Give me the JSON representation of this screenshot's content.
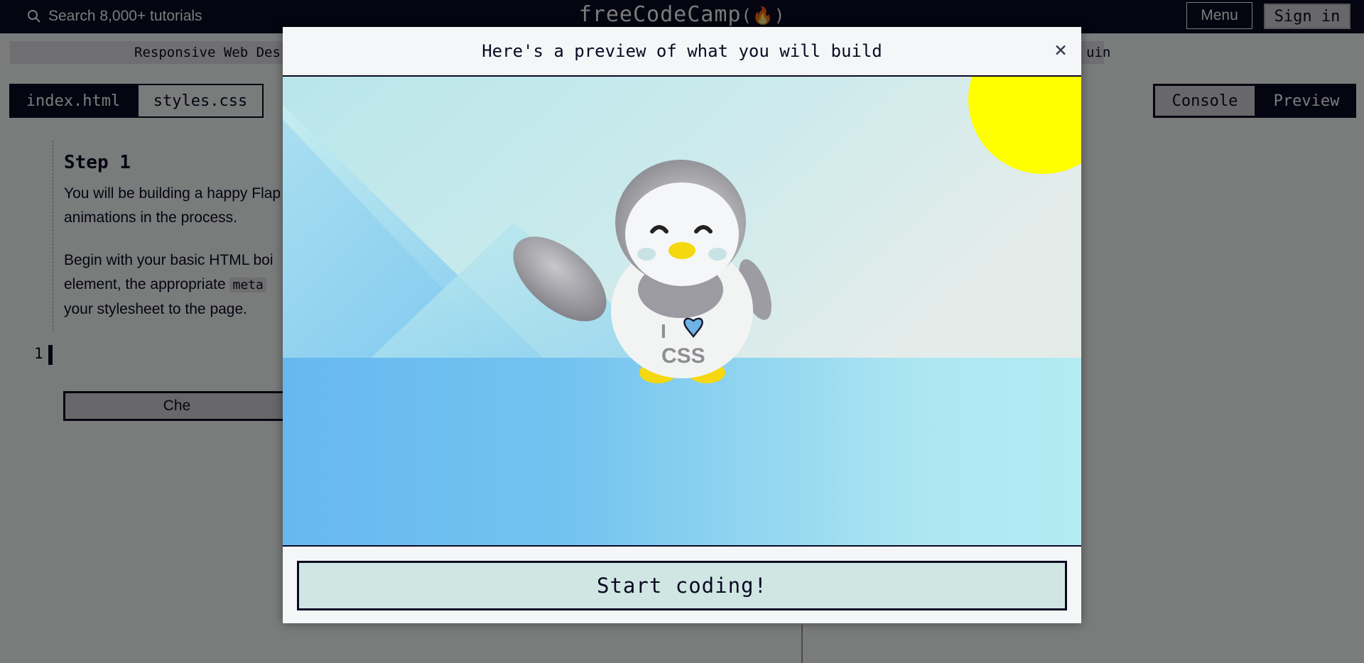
{
  "navbar": {
    "search_placeholder": "Search 8,000+ tutorials",
    "logo_text": "freeCodeCamp",
    "logo_flame": "(🔥)",
    "menu_label": "Menu",
    "signin_label": "Sign in"
  },
  "breadcrumb": {
    "left": "Responsive Web Des",
    "right": "uin"
  },
  "editor": {
    "tabs": [
      {
        "label": "index.html",
        "active": true
      },
      {
        "label": "styles.css",
        "active": false
      }
    ],
    "line_number": "1"
  },
  "view_tabs": {
    "console": "Console",
    "preview": "Preview"
  },
  "instructions": {
    "title": "Step 1",
    "p1": "You will be building a happy Flap",
    "p1b": "animations in the process.",
    "p2a": "Begin with your basic HTML boi",
    "p2b": "element, the appropriate ",
    "p2_code": "meta",
    "p2c": "your stylesheet to the page.",
    "check_label": "Che"
  },
  "modal": {
    "title": "Here's a preview of what you will build",
    "close_glyph": "×",
    "start_label": "Start coding!",
    "penguin_shirt_line1": "I",
    "penguin_shirt_line2": "CSS"
  },
  "colors": {
    "navy": "#0a0a23",
    "sky_top": "#b9e6ea",
    "ground": "#6fbdf0",
    "sun": "#ffff00",
    "beak": "#f5d80f"
  }
}
